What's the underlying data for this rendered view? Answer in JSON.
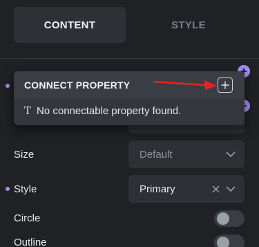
{
  "tabs": [
    {
      "label": "CONTENT",
      "active": true
    },
    {
      "label": "STYLE",
      "active": false
    }
  ],
  "popover": {
    "title": "CONNECT PROPERTY",
    "empty_message": "No connectable property found.",
    "add_icon": "plus-icon",
    "text_icon": "text-type-icon"
  },
  "fields": {
    "size": {
      "label": "Size",
      "value": "Default"
    },
    "style": {
      "label": "Style",
      "value": "Primary"
    },
    "circle": {
      "label": "Circle",
      "on": false
    },
    "outline": {
      "label": "Outline",
      "on": false
    }
  },
  "colors": {
    "accent": "#a78bfa",
    "annotation_arrow": "#e8231f",
    "background": "#1f2124",
    "control_bg": "#2d3035"
  }
}
